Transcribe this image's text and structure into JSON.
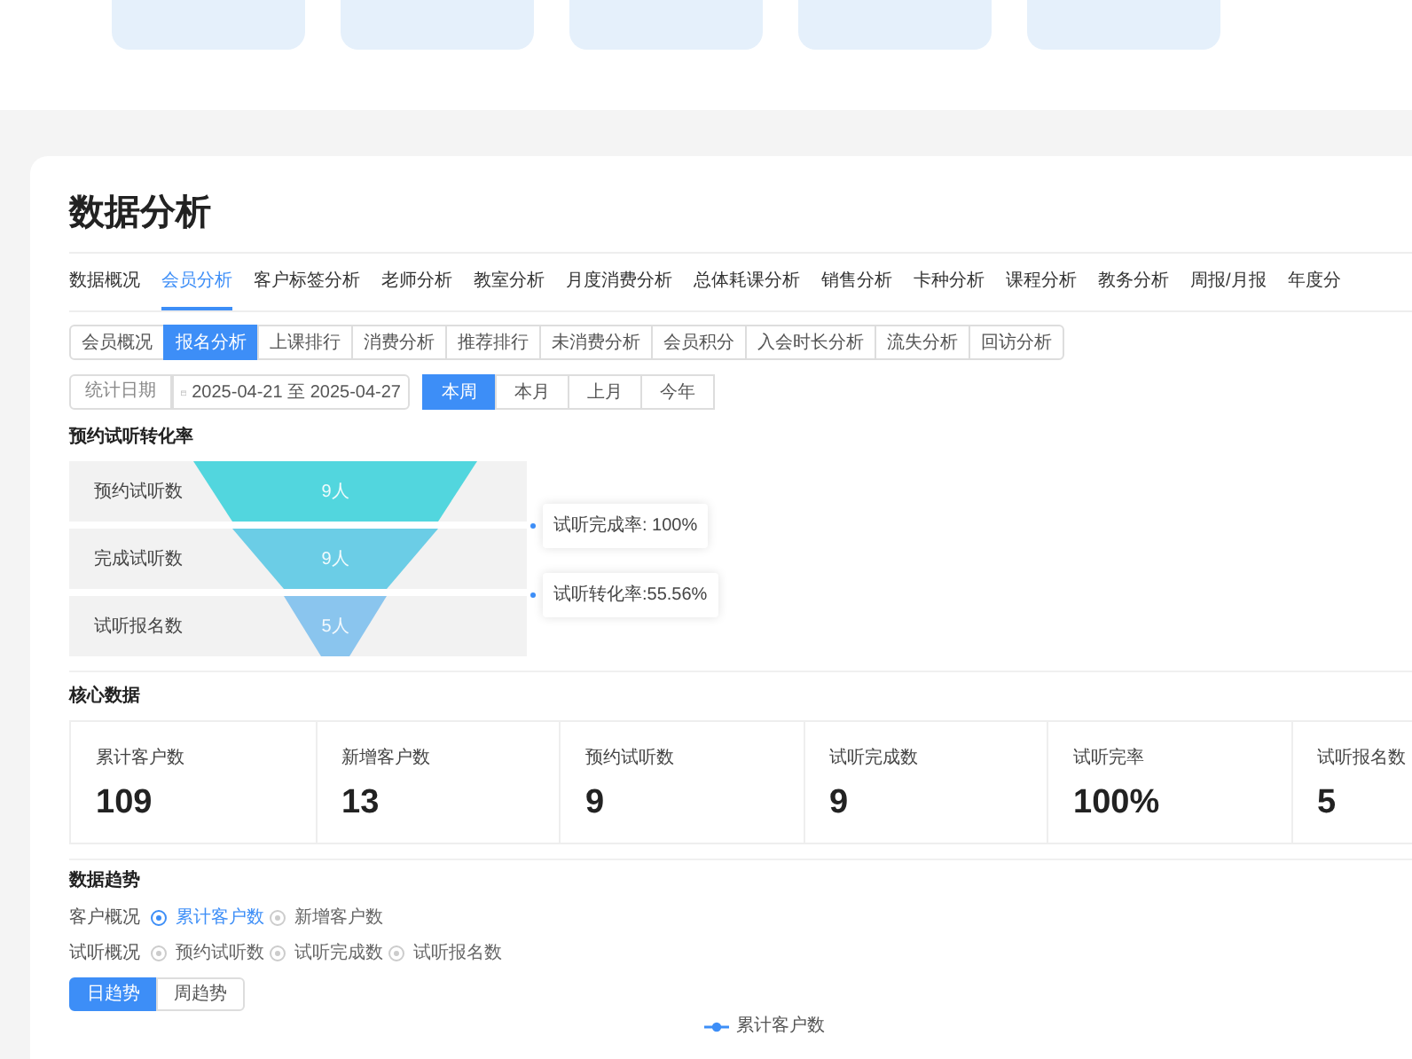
{
  "title": "数据分析",
  "tabs": [
    {
      "label": "数据概况",
      "selected": false
    },
    {
      "label": "会员分析",
      "selected": true
    },
    {
      "label": "客户标签分析",
      "selected": false
    },
    {
      "label": "老师分析",
      "selected": false
    },
    {
      "label": "教室分析",
      "selected": false
    },
    {
      "label": "月度消费分析",
      "selected": false
    },
    {
      "label": "总体耗课分析",
      "selected": false
    },
    {
      "label": "销售分析",
      "selected": false
    },
    {
      "label": "卡种分析",
      "selected": false
    },
    {
      "label": "课程分析",
      "selected": false
    },
    {
      "label": "教务分析",
      "selected": false
    },
    {
      "label": "周报/月报",
      "selected": false
    },
    {
      "label": "年度分",
      "selected": false
    }
  ],
  "subtabs": [
    {
      "label": "会员概况",
      "selected": false
    },
    {
      "label": "报名分析",
      "selected": true
    },
    {
      "label": "上课排行",
      "selected": false
    },
    {
      "label": "消费分析",
      "selected": false
    },
    {
      "label": "推荐排行",
      "selected": false
    },
    {
      "label": "未消费分析",
      "selected": false
    },
    {
      "label": "会员积分",
      "selected": false
    },
    {
      "label": "入会时长分析",
      "selected": false
    },
    {
      "label": "流失分析",
      "selected": false
    },
    {
      "label": "回访分析",
      "selected": false
    }
  ],
  "date_filter": {
    "label": "统计日期",
    "value": "2025-04-21 至 2025-04-27"
  },
  "periods": [
    {
      "label": "本周",
      "selected": true
    },
    {
      "label": "本月",
      "selected": false
    },
    {
      "label": "上月",
      "selected": false
    },
    {
      "label": "今年",
      "selected": false
    }
  ],
  "funnel": {
    "title": "预约试听转化率",
    "stages": [
      {
        "label": "预约试听数",
        "value": "9人",
        "color": "#52d6de"
      },
      {
        "label": "完成试听数",
        "value": "9人",
        "color": "#6bcde6"
      },
      {
        "label": "试听报名数",
        "value": "5人",
        "color": "#8ac5ee"
      }
    ],
    "rates": [
      "试听完成率: 100%",
      "试听转化率:55.56%"
    ]
  },
  "core": {
    "title": "核心数据",
    "metrics": [
      {
        "label": "累计客户数",
        "value": "109"
      },
      {
        "label": "新增客户数",
        "value": "13"
      },
      {
        "label": "预约试听数",
        "value": "9"
      },
      {
        "label": "试听完成数",
        "value": "9"
      },
      {
        "label": "试听完率",
        "value": "100%"
      },
      {
        "label": "试听报名数",
        "value": "5"
      }
    ]
  },
  "trend": {
    "title": "数据趋势",
    "groups": [
      {
        "label": "客户概况",
        "options": [
          {
            "label": "累计客户数",
            "selected": true
          },
          {
            "label": "新增客户数",
            "selected": false
          }
        ]
      },
      {
        "label": "试听概况",
        "options": [
          {
            "label": "预约试听数",
            "selected": false
          },
          {
            "label": "试听完成数",
            "selected": false
          },
          {
            "label": "试听报名数",
            "selected": false
          }
        ]
      }
    ],
    "modes": [
      {
        "label": "日趋势",
        "selected": true
      },
      {
        "label": "周趋势",
        "selected": false
      }
    ],
    "legend": "累计客户数"
  }
}
